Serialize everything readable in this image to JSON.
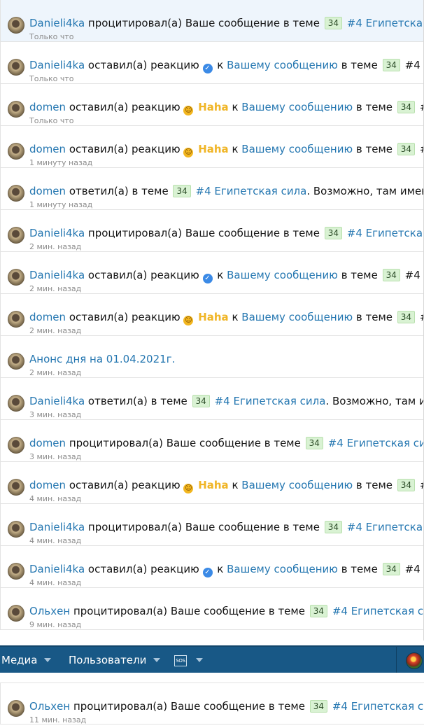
{
  "common": {
    "quoted": "процитировал(а) Ваше сообщение в теме",
    "reacted": "оставил(а) реакцию",
    "replied": "ответил(а) в теме",
    "to": "к",
    "your_message": "Вашему сообщению",
    "in_topic": "в теме",
    "badge": "34",
    "topic": "#4 Египетская сила",
    "haha": "Haha",
    "reply_tail": "Возможно, там имеются и д",
    "reply_tail2": "Возможно, там имеются",
    "like_icon": "like-icon",
    "laugh_icon": "laugh-icon",
    "accent": "#2577b1",
    "nav_color": "#185886"
  },
  "items": [
    {
      "user": "Danieli4ka",
      "time": "Только что"
    },
    {
      "user": "Danieli4ka",
      "time": "Только что"
    },
    {
      "user": "domen",
      "time": "Только что"
    },
    {
      "user": "domen",
      "time": "1 минуту назад"
    },
    {
      "user": "domen",
      "time": "1 минуту назад"
    },
    {
      "user": "Danieli4ka",
      "time": "2 мин. назад"
    },
    {
      "user": "Danieli4ka",
      "time": "2 мин. назад"
    },
    {
      "user": "domen",
      "time": "2 мин. назад"
    },
    {
      "announcement": "Анонс дня на 01.04.2021г.",
      "time": "2 мин. назад"
    },
    {
      "user": "Danieli4ka",
      "time": "3 мин. назад"
    },
    {
      "user": "domen",
      "time": "3 мин. назад"
    },
    {
      "user": "domen",
      "time": "4 мин. назад"
    },
    {
      "user": "Danieli4ka",
      "time": "4 мин. назад"
    },
    {
      "user": "Danieli4ka",
      "time": "4 мин. назад"
    },
    {
      "user": "Ольхен",
      "time": "9 мин. назад"
    },
    {
      "user": "Ольхен",
      "time": "11 мин. назад"
    }
  ],
  "nav": {
    "media": "Медиа",
    "users": "Пользователи",
    "sos": "SOS"
  }
}
